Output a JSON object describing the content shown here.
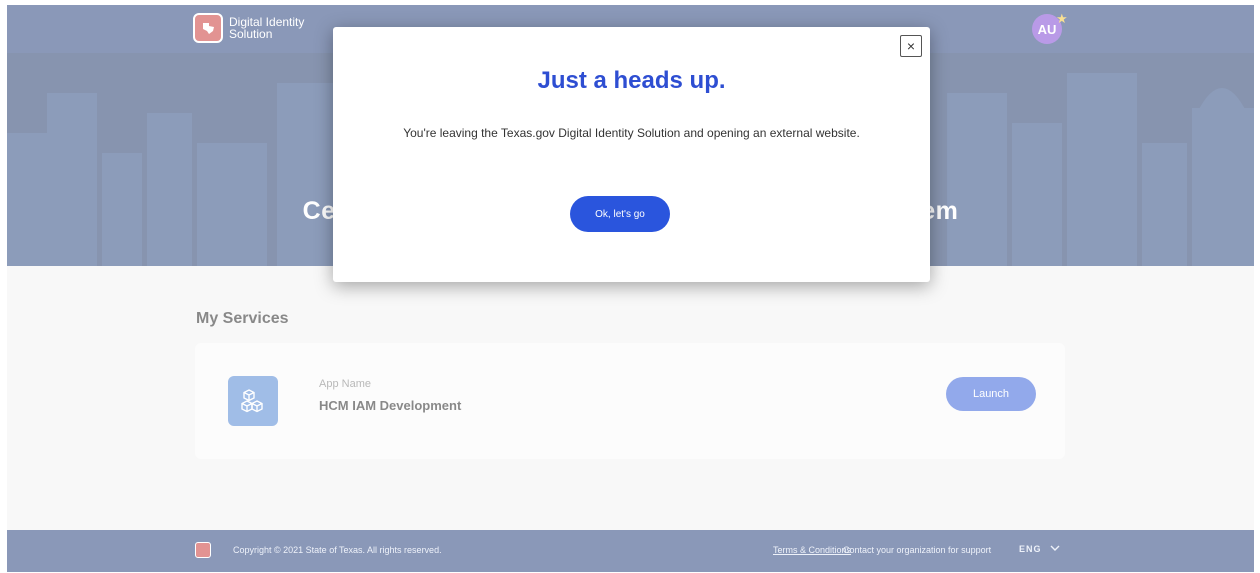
{
  "header": {
    "brand_line1": "Digital Identity",
    "brand_line2": "Solution",
    "avatar_initials": "AU"
  },
  "hero": {
    "title": "Centralized Identity and Access Management System"
  },
  "services": {
    "heading": "My Services",
    "items": [
      {
        "label": "App Name",
        "name": "HCM IAM Development",
        "launch_label": "Launch",
        "icon": "cubes-icon"
      }
    ]
  },
  "footer": {
    "copyright": "Copyright © 2021 State of Texas. All rights reserved.",
    "terms_label": "Terms & Conditions",
    "contact": "Contact your organization for support",
    "language": "ENG"
  },
  "modal": {
    "title": "Just a heads up.",
    "body": "You're leaving the Texas.gov Digital Identity Solution and opening an external website.",
    "confirm_label": "Ok, let's go",
    "close_symbol": "×"
  },
  "colors": {
    "header_bg": "#1f3a78",
    "hero_bg": "#193366",
    "accent": "#2a55dd",
    "modal_title": "#2e4ed2",
    "avatar": "#7a3fd1"
  }
}
